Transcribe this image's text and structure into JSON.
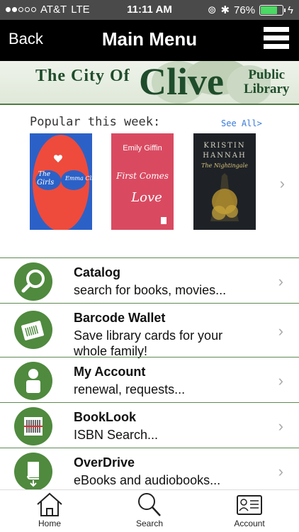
{
  "status_bar": {
    "carrier": "AT&T",
    "network": "LTE",
    "time": "11:11 AM",
    "battery_percent": "76%",
    "battery_level": 0.76
  },
  "nav": {
    "back_label": "Back",
    "title": "Main Menu"
  },
  "banner": {
    "city_of": "The City Of",
    "clive": "Clive",
    "public_line1": "Public",
    "public_line2": "Library"
  },
  "popular": {
    "title": "Popular this week:",
    "see_all": "See All>",
    "books": [
      {
        "author": "Emma Cline",
        "title_a": "The",
        "title_b": "Girls"
      },
      {
        "author": "Emily Giffin",
        "title_a": "First Comes",
        "title_b": "Love"
      },
      {
        "author_a": "KRISTIN",
        "author_b": "HANNAH",
        "title": "The Nightingale"
      }
    ]
  },
  "menu": {
    "items": [
      {
        "title": "Catalog",
        "subtitle": "search for books, movies..."
      },
      {
        "title": "Barcode Wallet",
        "subtitle": "Save library cards for your whole family!"
      },
      {
        "title": "My Account",
        "subtitle": "renewal, requests..."
      },
      {
        "title": "BookLook",
        "subtitle": "ISBN Search..."
      },
      {
        "title": "OverDrive",
        "subtitle": "eBooks and audiobooks..."
      }
    ]
  },
  "tabs": {
    "home": "Home",
    "search": "Search",
    "account": "Account"
  },
  "colors": {
    "accent_green": "#4f8a3e",
    "nav_black": "#000000",
    "link_blue": "#3a7bd5"
  }
}
